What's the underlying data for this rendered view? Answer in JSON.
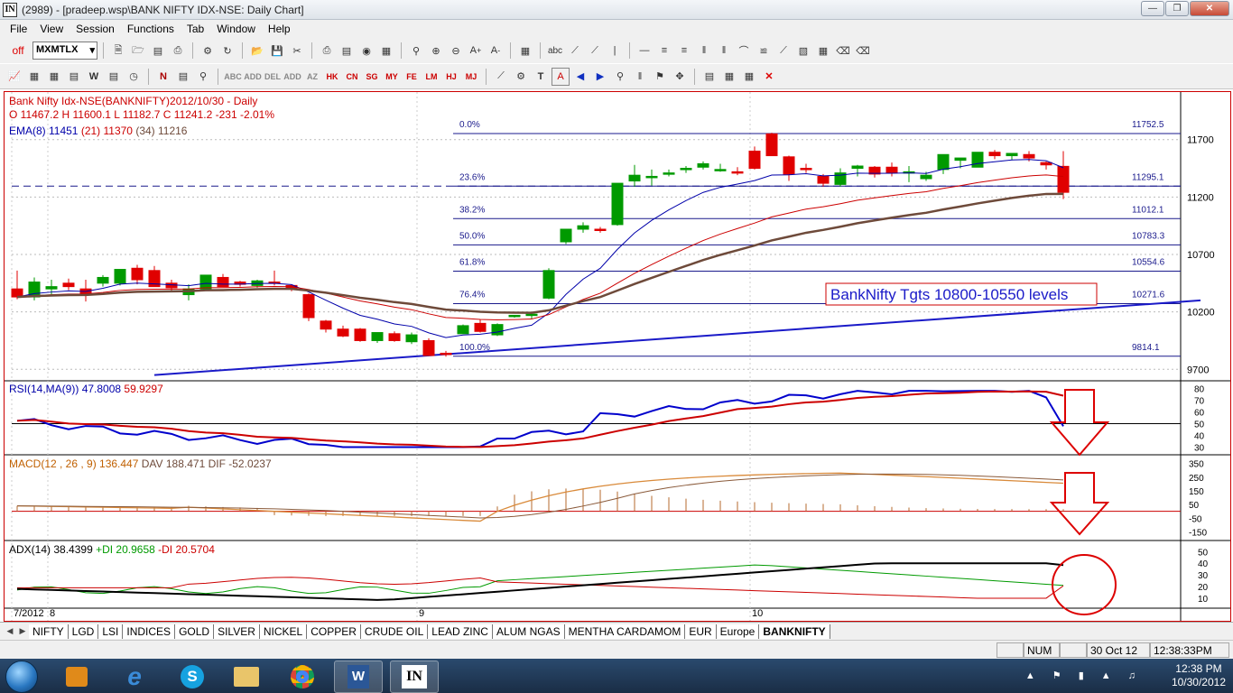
{
  "window": {
    "title": "(2989) - [pradeep.wsp\\BANK NIFTY IDX-NSE: Daily Chart]",
    "app_icon": "IN",
    "buttons": [
      "minimize",
      "maximize",
      "close"
    ]
  },
  "menu": [
    "File",
    "View",
    "Session",
    "Functions",
    "Tab",
    "Window",
    "Help"
  ],
  "toolbar": {
    "off_label": "off",
    "exchange_combo": "MXMTLX",
    "tab_letters": [
      "ABC",
      "ADD",
      "DEL",
      "ADD",
      "AZ",
      "HK",
      "CN",
      "SG",
      "MY",
      "FE",
      "LM",
      "HJ",
      "MJ"
    ]
  },
  "chart": {
    "header_line1": "Bank Nifty Idx-NSE(BANKNIFTY)2012/10/30   - Daily",
    "header_line2": "O 11467.2 H 11600.1 L 11182.7 C 11241.2  -231  -2.01%",
    "ema_label": "EMA(8)",
    "ema8": "11451",
    "ema21_label": "(21)",
    "ema21": "11370",
    "ema34_label": "(34)",
    "ema34": "11216",
    "annotation": "BankNifty Tgts 10800-10550 levels",
    "price_axis": [
      "11700",
      "11200",
      "10700",
      "10200",
      "9700"
    ],
    "fib_levels": [
      {
        "pct": "0.0%",
        "value": "11752.5"
      },
      {
        "pct": "23.6%",
        "value": "11295.1"
      },
      {
        "pct": "38.2%",
        "value": "11012.1"
      },
      {
        "pct": "50.0%",
        "value": "10783.3"
      },
      {
        "pct": "61.8%",
        "value": "10554.6"
      },
      {
        "pct": "76.4%",
        "value": "10271.6"
      },
      {
        "pct": "100.0%",
        "value": "9814.1"
      }
    ],
    "x_labels": [
      "7/2012",
      "8",
      "9",
      "10"
    ],
    "rsi": {
      "label": "RSI(14,MA(9))",
      "value": "47.8008",
      "ma": "59.9297",
      "axis": [
        "80",
        "70",
        "60",
        "50",
        "40",
        "30"
      ]
    },
    "macd": {
      "label": "MACD(12 , 26 , 9)",
      "macd": "136.447",
      "dav_label": "DAV",
      "dav": "188.471",
      "dif_label": "DIF",
      "dif": "-52.0237",
      "axis": [
        "350",
        "250",
        "150",
        "50",
        "-50",
        "-150"
      ]
    },
    "adx": {
      "label": "ADX(14)",
      "adx": "38.4399",
      "pdi_label": "+DI",
      "pdi": "20.9658",
      "mdi_label": "-DI",
      "mdi": "20.5704",
      "axis": [
        "50",
        "40",
        "30",
        "20",
        "10"
      ]
    }
  },
  "chart_data": {
    "type": "candlestick",
    "title": "Bank Nifty Idx-NSE(BANKNIFTY)2012/10/30 - Daily",
    "ylim": [
      9600,
      11800
    ],
    "candles": [
      [
        10400,
        10560,
        10310,
        10330
      ],
      [
        10330,
        10500,
        10300,
        10460
      ],
      [
        10400,
        10480,
        10350,
        10420
      ],
      [
        10450,
        10490,
        10390,
        10420
      ],
      [
        10400,
        10480,
        10290,
        10360
      ],
      [
        10450,
        10520,
        10420,
        10500
      ],
      [
        10450,
        10560,
        10430,
        10570
      ],
      [
        10580,
        10610,
        10440,
        10480
      ],
      [
        10560,
        10600,
        10420,
        10420
      ],
      [
        10450,
        10480,
        10380,
        10410
      ],
      [
        10350,
        10440,
        10300,
        10400
      ],
      [
        10400,
        10520,
        10390,
        10520
      ],
      [
        10500,
        10530,
        10420,
        10420
      ],
      [
        10460,
        10470,
        10420,
        10440
      ],
      [
        10430,
        10480,
        10410,
        10470
      ],
      [
        10460,
        10560,
        10430,
        10450
      ],
      [
        10430,
        10440,
        10380,
        10400
      ],
      [
        10350,
        10360,
        10120,
        10150
      ],
      [
        10120,
        10130,
        10020,
        10050
      ],
      [
        10050,
        10080,
        9980,
        9990
      ],
      [
        10050,
        10060,
        9940,
        9950
      ],
      [
        9950,
        10020,
        9930,
        10020
      ],
      [
        10010,
        10030,
        9940,
        9950
      ],
      [
        9940,
        10020,
        9920,
        10000
      ],
      [
        9950,
        9970,
        9820,
        9820
      ],
      [
        9840,
        9860,
        9810,
        9830
      ],
      [
        10010,
        10090,
        10010,
        10080
      ],
      [
        10100,
        10130,
        10020,
        10030
      ],
      [
        10000,
        10100,
        9990,
        10090
      ],
      [
        10170,
        10170,
        10150,
        10170
      ],
      [
        10170,
        10200,
        10140,
        10180
      ],
      [
        10320,
        10580,
        10310,
        10560
      ],
      [
        10810,
        10920,
        10790,
        10920
      ],
      [
        10920,
        10980,
        10890,
        10950
      ],
      [
        10920,
        10940,
        10890,
        10910
      ],
      [
        10960,
        11300,
        10950,
        11320
      ],
      [
        11340,
        11480,
        11290,
        11390
      ],
      [
        11380,
        11440,
        11300,
        11380
      ],
      [
        11410,
        11440,
        11380,
        11410
      ],
      [
        11440,
        11470,
        11410,
        11450
      ],
      [
        11460,
        11510,
        11440,
        11490
      ],
      [
        11440,
        11490,
        11420,
        11440
      ],
      [
        11420,
        11460,
        11390,
        11410
      ],
      [
        11600,
        11640,
        11440,
        11450
      ],
      [
        11750,
        11760,
        11560,
        11560
      ],
      [
        11550,
        11560,
        11340,
        11400
      ],
      [
        11450,
        11490,
        11410,
        11440
      ],
      [
        11380,
        11400,
        11290,
        11320
      ],
      [
        11310,
        11450,
        11290,
        11410
      ],
      [
        11450,
        11480,
        11380,
        11470
      ],
      [
        11460,
        11470,
        11370,
        11400
      ],
      [
        11460,
        11500,
        11380,
        11410
      ],
      [
        11410,
        11470,
        11330,
        11420
      ],
      [
        11360,
        11420,
        11340,
        11390
      ],
      [
        11440,
        11570,
        11400,
        11570
      ],
      [
        11520,
        11540,
        11450,
        11540
      ],
      [
        11460,
        11590,
        11460,
        11590
      ],
      [
        11590,
        11610,
        11530,
        11560
      ],
      [
        11560,
        11580,
        11520,
        11580
      ],
      [
        11570,
        11600,
        11510,
        11540
      ],
      [
        11500,
        11510,
        11440,
        11480
      ],
      [
        11467.2,
        11600.1,
        11182.7,
        11241.2
      ]
    ],
    "series": [
      {
        "name": "EMA(8)",
        "color": "#0000aa"
      },
      {
        "name": "(21)",
        "color": "#cc0000"
      },
      {
        "name": "(34)",
        "color": "#6e4a3a"
      }
    ],
    "fibonacci": [
      {
        "pct": "0.0%",
        "value": 11752.5
      },
      {
        "pct": "23.6%",
        "value": 11295.1
      },
      {
        "pct": "38.2%",
        "value": 11012.1
      },
      {
        "pct": "50.0%",
        "value": 10783.3
      },
      {
        "pct": "61.8%",
        "value": 10554.6
      },
      {
        "pct": "76.4%",
        "value": 10271.6
      },
      {
        "pct": "100.0%",
        "value": 9814.1
      }
    ],
    "horizontal_dashed_line": 11295,
    "trendline": [
      [
        8,
        9650
      ],
      [
        69,
        10300
      ]
    ]
  },
  "sheets": [
    "NIFTY",
    "LGD",
    "LSI",
    "INDICES",
    "GOLD",
    "SILVER",
    "NICKEL",
    "COPPER",
    "CRUDE OIL",
    "LEAD ZINC",
    "ALUM NGAS",
    "MENTHA CARDAMOM",
    "EUR",
    "Europe",
    "BANKNIFTY"
  ],
  "active_sheet": "BANKNIFTY",
  "status": {
    "num": "NUM",
    "date": "30 Oct 12",
    "time": "12:38:33PM"
  },
  "taskbar": {
    "clock_time": "12:38 PM",
    "clock_date": "10/30/2012"
  }
}
